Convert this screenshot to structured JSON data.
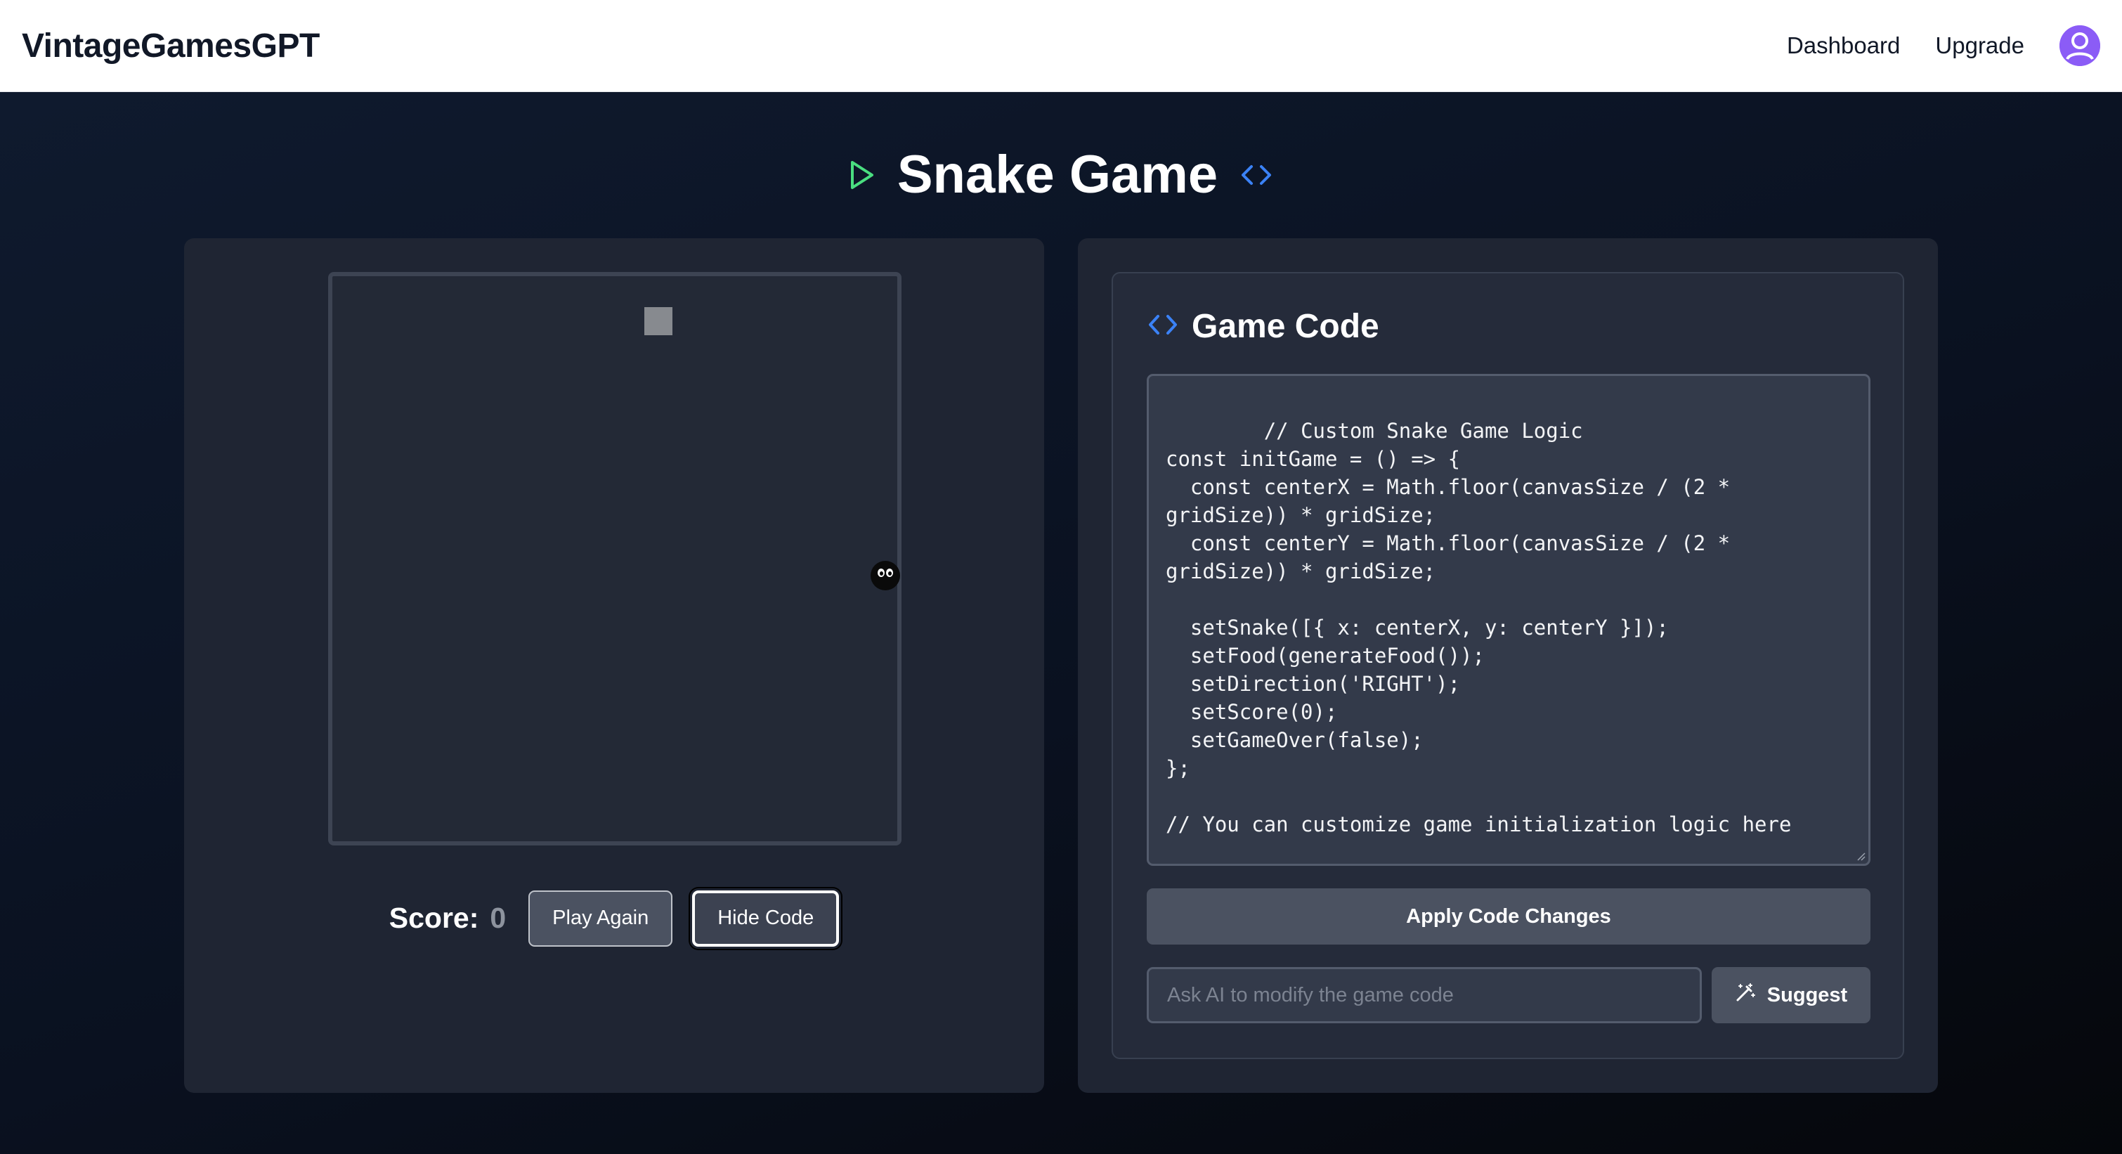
{
  "header": {
    "brand": "VintageGamesGPT",
    "nav": [
      {
        "label": "Dashboard"
      },
      {
        "label": "Upgrade"
      }
    ],
    "avatar_icon": "user-avatar-icon"
  },
  "page": {
    "title": "Snake Game",
    "title_icons": [
      "play-icon",
      "code-icon"
    ]
  },
  "game": {
    "score_label": "Score:",
    "score_value": "0",
    "play_again_label": "Play Again",
    "hide_code_label": "Hide Code"
  },
  "code_panel": {
    "title": "Game Code",
    "code": "// Custom Snake Game Logic\nconst initGame = () => {\n  const centerX = Math.floor(canvasSize / (2 * gridSize)) * gridSize;\n  const centerY = Math.floor(canvasSize / (2 * gridSize)) * gridSize;\n\n  setSnake([{ x: centerX, y: centerY }]);\n  setFood(generateFood());\n  setDirection('RIGHT');\n  setScore(0);\n  setGameOver(false);\n};\n\n// You can customize game initialization logic here",
    "apply_label": "Apply Code Changes",
    "ai_placeholder": "Ask AI to modify the game code",
    "ai_value": "",
    "suggest_label": "Suggest"
  },
  "colors": {
    "play_icon": "#4ade80",
    "code_icon": "#3b82f6",
    "avatar": "#8b5cf6"
  }
}
